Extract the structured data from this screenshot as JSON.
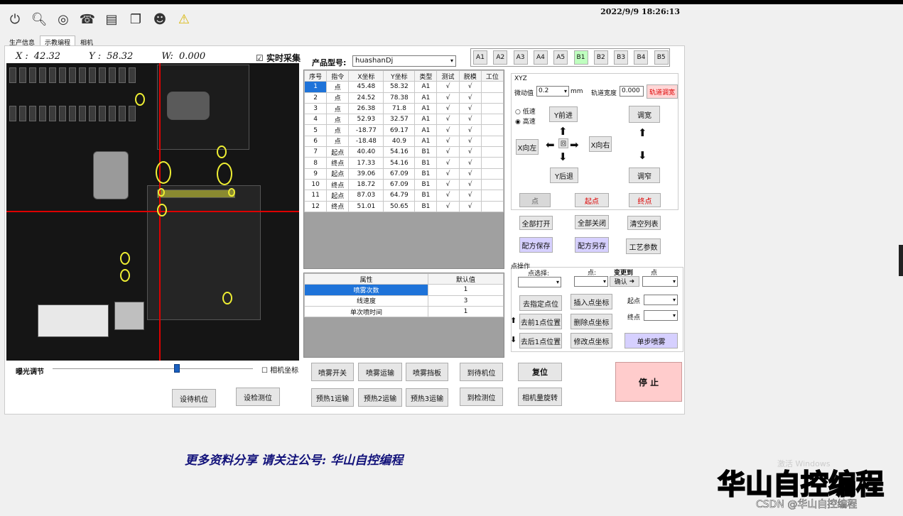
{
  "datetime": "2022/9/9  18:26:13",
  "tabs": [
    "生产信息",
    "示教编程",
    "相机"
  ],
  "coords": {
    "x_label": "X :",
    "x": "42.32",
    "y_label": "Y :",
    "y": "58.32",
    "w_label": "W:",
    "w": "0.000"
  },
  "realtime_label": "实时采集",
  "exposure_label": "曝光调节",
  "exposure_level": 0.62,
  "camera_coord_label": "相机坐标",
  "product": {
    "label": "产品型号:",
    "value": "huashanDj"
  },
  "axes_buttons": [
    "A1",
    "A2",
    "A3",
    "A4",
    "A5",
    "B1",
    "B2",
    "B3",
    "B4",
    "B5"
  ],
  "axes_selected": "B1",
  "table": {
    "headers": [
      "序号",
      "指令",
      "X坐标",
      "Y坐标",
      "类型",
      "测试",
      "脱模",
      "工位"
    ],
    "rows": [
      [
        "1",
        "点",
        "45.48",
        "58.32",
        "A1",
        "√",
        "√",
        ""
      ],
      [
        "2",
        "点",
        "24.52",
        "78.38",
        "A1",
        "√",
        "√",
        ""
      ],
      [
        "3",
        "点",
        "26.38",
        "71.8",
        "A1",
        "√",
        "√",
        ""
      ],
      [
        "4",
        "点",
        "52.93",
        "32.57",
        "A1",
        "√",
        "√",
        ""
      ],
      [
        "5",
        "点",
        "-18.77",
        "69.17",
        "A1",
        "√",
        "√",
        ""
      ],
      [
        "6",
        "点",
        "-18.48",
        "40.9",
        "A1",
        "√",
        "√",
        ""
      ],
      [
        "7",
        "起点",
        "40.40",
        "54.16",
        "B1",
        "√",
        "√",
        ""
      ],
      [
        "8",
        "终点",
        "17.33",
        "54.16",
        "B1",
        "√",
        "√",
        ""
      ],
      [
        "9",
        "起点",
        "39.06",
        "67.09",
        "B1",
        "√",
        "√",
        ""
      ],
      [
        "10",
        "终点",
        "18.72",
        "67.09",
        "B1",
        "√",
        "√",
        ""
      ],
      [
        "11",
        "起点",
        "87.03",
        "64.79",
        "B1",
        "√",
        "√",
        ""
      ],
      [
        "12",
        "终点",
        "51.01",
        "50.65",
        "B1",
        "√",
        "√",
        ""
      ]
    ]
  },
  "props": {
    "headers": [
      "属性",
      "默认值"
    ],
    "rows": [
      [
        "喷雾次数",
        "1"
      ],
      [
        "线速度",
        "3"
      ],
      [
        "单次喷时间",
        "1"
      ]
    ]
  },
  "xyz": {
    "title": "XYZ",
    "jog_label": "微动值",
    "jog_value": "0.2",
    "jog_unit": "mm",
    "track_label": "轨道宽度",
    "track_value": "0.000",
    "track_button": "轨道调宽",
    "low_speed": "低速",
    "high_speed": "高速",
    "y_forward": "Y前进",
    "y_back": "Y后退",
    "x_left": "X向左",
    "x_right": "X向右",
    "home": "回",
    "widen": "调宽",
    "narrow": "调窄",
    "point": "点",
    "start_point": "起点",
    "end_point": "终点"
  },
  "buttons": {
    "open_all": "全部打开",
    "close_all": "全部关闭",
    "clear_list": "清空列表",
    "save_recipe": "配方保存",
    "save_recipe_as": "配方另存",
    "process_params": "工艺参数",
    "spray_switch": "喷雾开关",
    "spray_run": "喷雾运输",
    "spray_baffle": "喷雾挡板",
    "to_wait": "到待机位",
    "reset": "复位",
    "preheat1": "预热1运输",
    "preheat2": "预热2运输",
    "preheat3": "预热3运输",
    "to_check": "到检测位",
    "camera_rotate": "相机量旋转",
    "set_wait": "设待机位",
    "set_check": "设检测位",
    "stop": "停 止"
  },
  "pointop": {
    "title": "点操作",
    "select_label": "点选择:",
    "point_label": "点:",
    "change_label": "变更到",
    "point2_label": "点",
    "confirm": "确认",
    "go_point": "去指定点位",
    "insert": "插入点坐标",
    "prev": "去前1点位置",
    "delete": "删除点坐标",
    "next": "去后1点位置",
    "modify": "修改点坐标",
    "start_label": "起点",
    "end_label": "终点",
    "single_spray": "单步喷雾"
  },
  "footer_text": "更多资料分享 请关注公号: 华山自控编程",
  "watermark": "华山自控编程",
  "windows_mark": "激活 Windows",
  "csdn": "CSDN @华山自控编程"
}
